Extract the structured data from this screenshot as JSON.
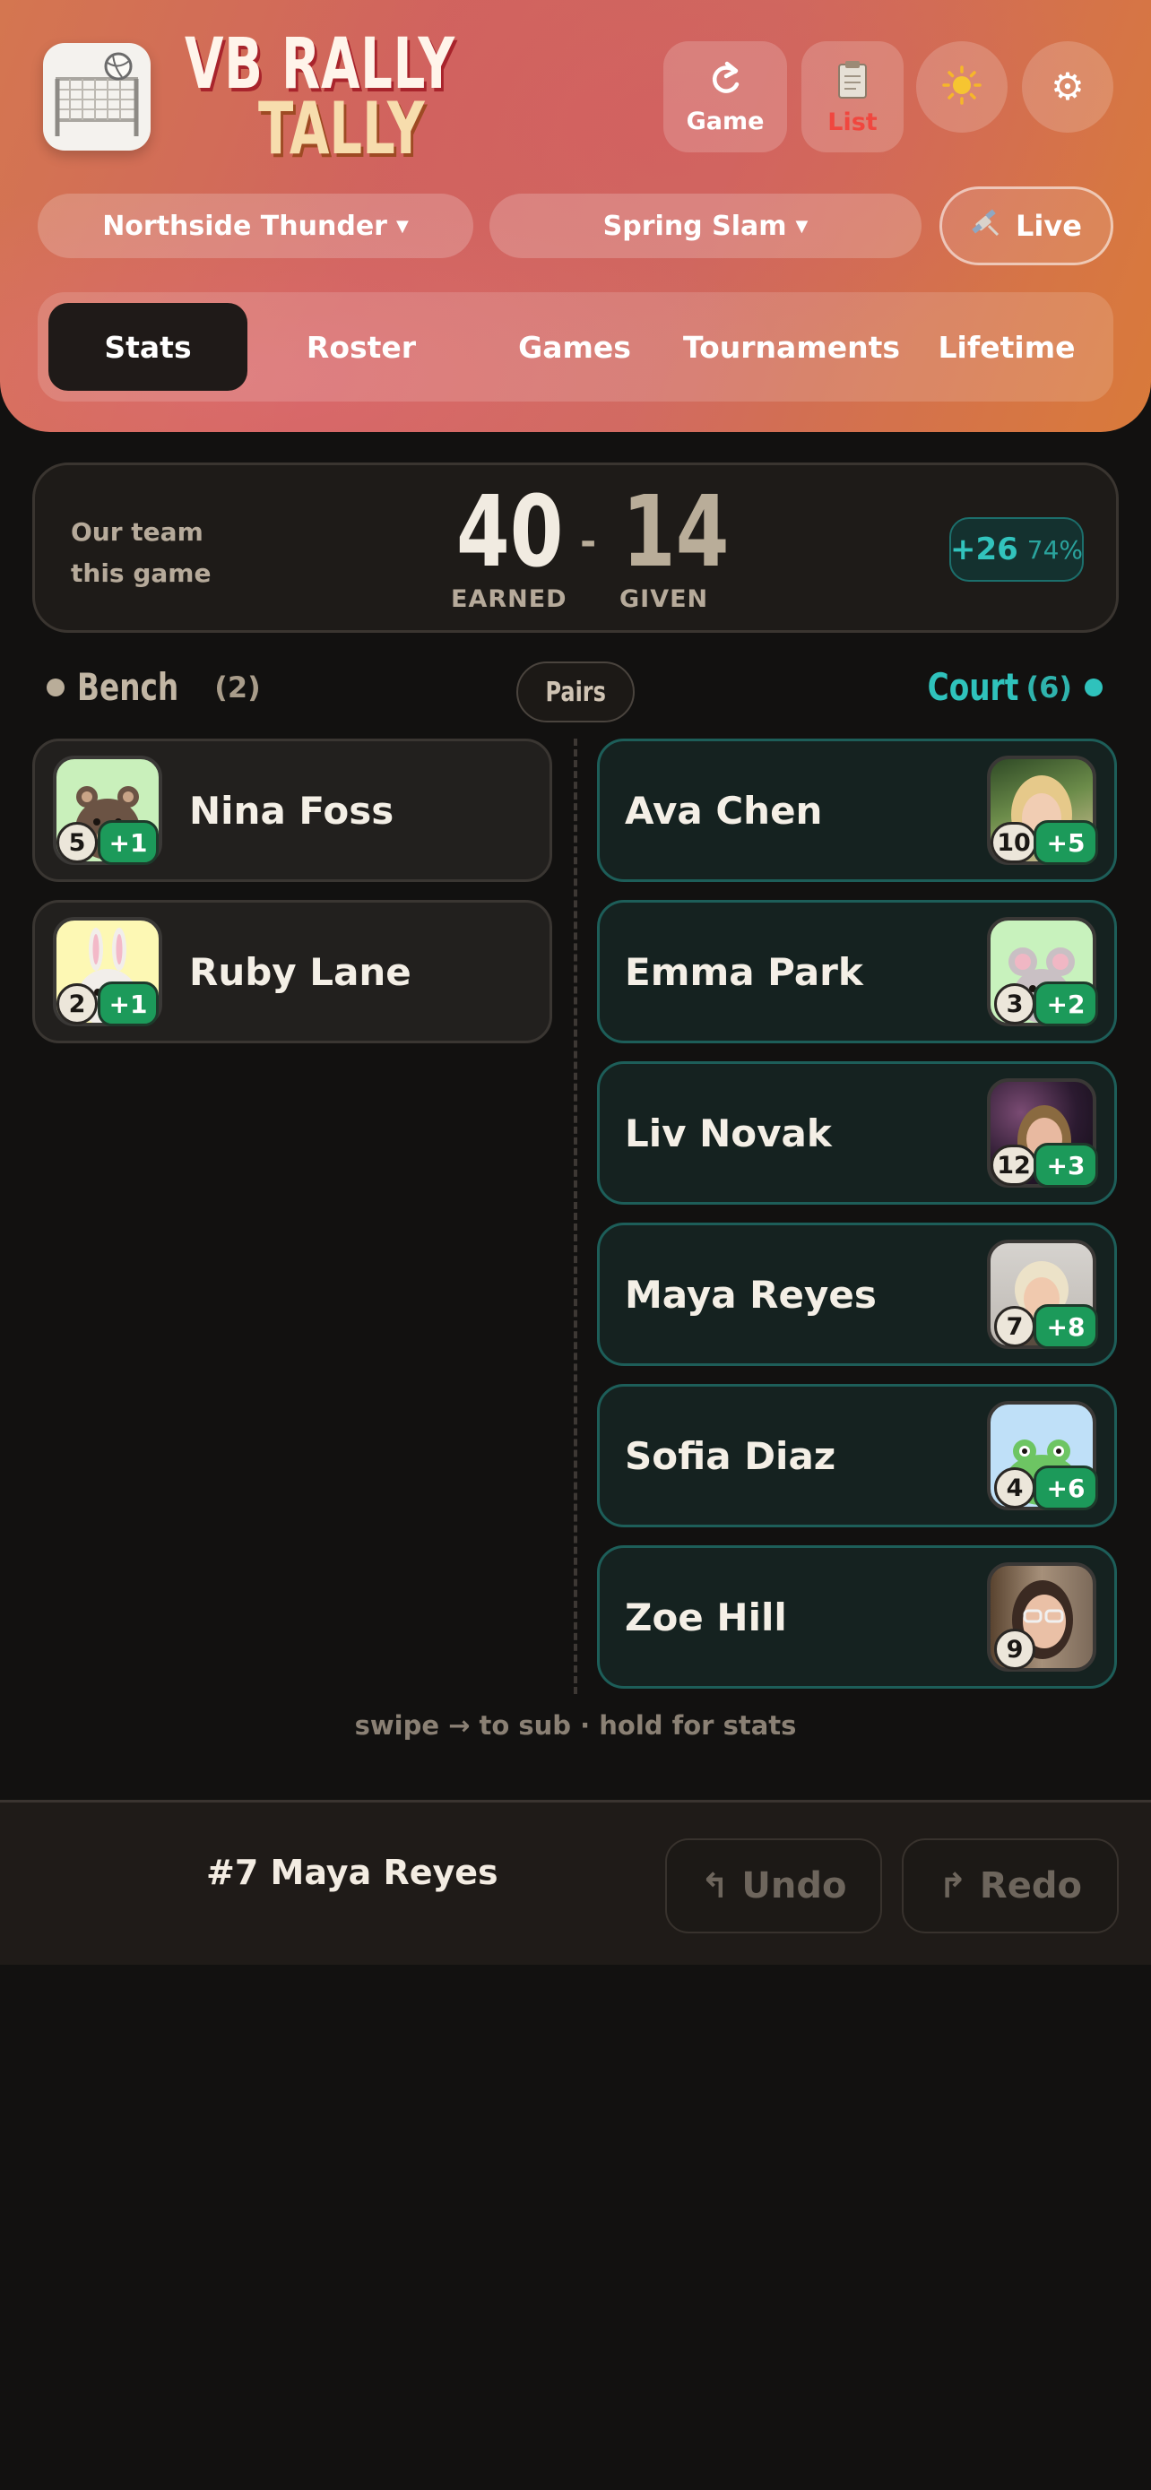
{
  "app": {
    "title_line1": "VB RALLY",
    "title_line2": "TALLY"
  },
  "header_buttons": {
    "game_label": "Game",
    "list_label": "List"
  },
  "selectors": {
    "team": "Northside Thunder",
    "tournament": "Spring Slam",
    "live_label": "Live"
  },
  "tabs": [
    {
      "label": "Stats",
      "active": true
    },
    {
      "label": "Roster",
      "active": false
    },
    {
      "label": "Games",
      "active": false
    },
    {
      "label": "Tournaments",
      "active": false
    },
    {
      "label": "Lifetime",
      "active": false
    }
  ],
  "score": {
    "caption_line1": "Our team",
    "caption_line2": "this game",
    "earned": "40",
    "earned_label": "EARNED",
    "separator": "-",
    "given": "14",
    "given_label": "GIVEN",
    "diff": "+26",
    "pct": "74%"
  },
  "bench": {
    "title": "Bench",
    "count": "(2)",
    "players": [
      {
        "name": "Nina Foss",
        "number": "5",
        "plus": "+1",
        "avatar": "bear-icon"
      },
      {
        "name": "Ruby Lane",
        "number": "2",
        "plus": "+1",
        "avatar": "bunny-icon"
      }
    ]
  },
  "pairs_label": "Pairs",
  "court": {
    "title": "Court",
    "count": "(6)",
    "players": [
      {
        "name": "Ava Chen",
        "number": "10",
        "plus": "+5",
        "avatar": "photo"
      },
      {
        "name": "Emma Park",
        "number": "3",
        "plus": "+2",
        "avatar": "mouse-icon"
      },
      {
        "name": "Liv Novak",
        "number": "12",
        "plus": "+3",
        "avatar": "photo"
      },
      {
        "name": "Maya Reyes",
        "number": "7",
        "plus": "+8",
        "avatar": "photo"
      },
      {
        "name": "Sofia Diaz",
        "number": "4",
        "plus": "+6",
        "avatar": "frog-icon"
      },
      {
        "name": "Zoe Hill",
        "number": "9",
        "plus": "",
        "avatar": "photo"
      }
    ]
  },
  "hint": "swipe → to sub · hold for stats",
  "footer": {
    "selected_player": "#7 Maya Reyes",
    "undo_label": "Undo",
    "redo_label": "Redo"
  },
  "colors": {
    "accent_teal": "#32c3bd",
    "bench_dot": "#b9ad99",
    "plus_green": "#1c9a5a",
    "list_red": "#f0473f"
  }
}
